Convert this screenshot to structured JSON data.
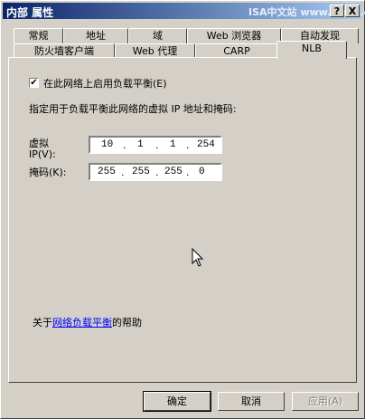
{
  "window": {
    "title": "内部 属性",
    "watermark": "ISA中文站 www.isacn.org"
  },
  "titlebar_buttons": {
    "help": "?",
    "close": "X"
  },
  "tabs_row1": [
    "常规",
    "地址",
    "域",
    "Web 浏览器",
    "自动发现"
  ],
  "tabs_row2": [
    "防火墙客户端",
    "Web 代理",
    "CARP",
    "NLB"
  ],
  "active_tab": "NLB",
  "nlb": {
    "enable_checkbox_label": "在此网络上启用负载平衡(E)",
    "enable_checked": true,
    "description": "指定用于负载平衡此网络的虚拟 IP 地址和掩码:",
    "vip_label_line1": "虚拟",
    "vip_label_line2": "IP(V):",
    "vip": [
      "10",
      "1",
      "1",
      "254"
    ],
    "mask_label": "掩码(K):",
    "mask": [
      "255",
      "255",
      "255",
      "0"
    ],
    "help_prefix": "关于",
    "help_link": "网络负载平衡",
    "help_suffix": "的帮助"
  },
  "buttons": {
    "ok": "确定",
    "cancel": "取消",
    "apply": "应用(A)"
  }
}
